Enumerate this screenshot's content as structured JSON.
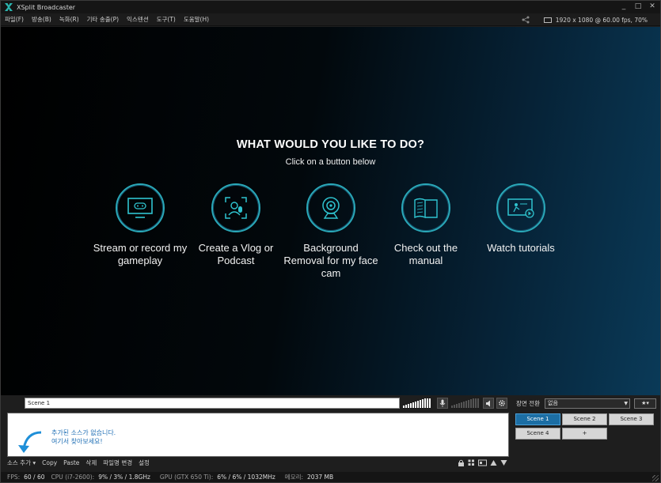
{
  "window": {
    "title": "XSplit Broadcaster",
    "controls": [
      "_",
      "□",
      "✕"
    ]
  },
  "menu": [
    "파일(F)",
    "방송(B)",
    "녹화(R)",
    "기타 송출(P)",
    "익스텐션",
    "도구(T)",
    "도움말(H)"
  ],
  "resolution": "1920 x 1080 @ 60.00 fps, 70%",
  "preview": {
    "title": "WHAT WOULD YOU LIKE TO DO?",
    "subtitle": "Click on a button below",
    "options": [
      {
        "label": "Stream or record my gameplay",
        "icon": "gamepad-monitor-icon"
      },
      {
        "label": "Create a Vlog or Podcast",
        "icon": "microphone-icon"
      },
      {
        "label": "Background Removal for my face cam",
        "icon": "webcam-icon"
      },
      {
        "label": "Check out the manual",
        "icon": "book-icon"
      },
      {
        "label": "Watch tutorials",
        "icon": "play-tutorial-icon"
      }
    ]
  },
  "scene_name": "Scene 1",
  "sources": {
    "hint_line1": "추가된 소스가 없습니다.",
    "hint_line2": "여기서 찾아보세요!"
  },
  "source_toolbar": [
    "소스 추가 ▾",
    "Copy",
    "Paste",
    "삭제",
    "파일명 변경",
    "설정"
  ],
  "transition": {
    "label": "장면 전환",
    "value": "없음",
    "fav": "★▾"
  },
  "scenes": [
    {
      "label": "Scene 1",
      "active": true
    },
    {
      "label": "Scene 2",
      "active": false
    },
    {
      "label": "Scene 3",
      "active": false
    },
    {
      "label": "Scene 4",
      "active": false
    },
    {
      "label": "+",
      "active": false
    }
  ],
  "status": {
    "fps_label": "FPS:",
    "fps": "60 / 60",
    "cpu_label": "CPU (i7-2600):",
    "cpu": "9% / 3% / 1.8GHz",
    "gpu_label": "GPU (GTX 650 Ti):",
    "gpu": "6% / 6% / 1032MHz",
    "mem_label": "메모리:",
    "mem": "2037 MB"
  },
  "colors": {
    "accent": "#1c6ea4",
    "icon_ring": "#2aa8b8",
    "hint": "#1f6fb5"
  }
}
